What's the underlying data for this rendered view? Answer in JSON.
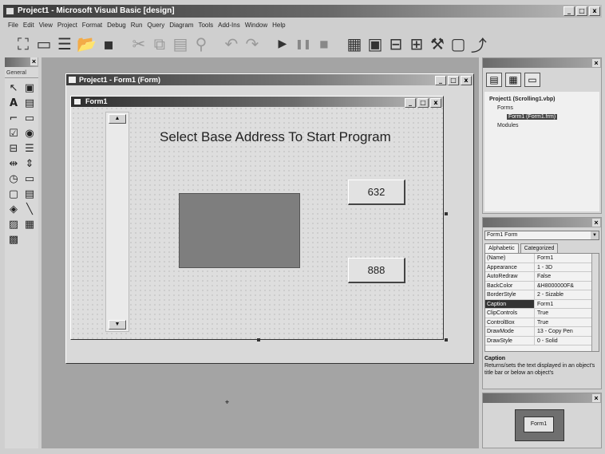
{
  "window": {
    "title": "Project1 - Microsoft Visual Basic [design]",
    "minimize": "_",
    "maximize": "□",
    "close": "x"
  },
  "menu": [
    "File",
    "Edit",
    "View",
    "Project",
    "Format",
    "Debug",
    "Run",
    "Query",
    "Diagram",
    "Tools",
    "Add-Ins",
    "Window",
    "Help"
  ],
  "toolbar_icons": [
    "add-project-icon",
    "add-form-icon",
    "menu-editor-icon",
    "open-project-icon",
    "save-project-icon",
    "cut-icon",
    "copy-icon",
    "paste-icon",
    "find-icon",
    "undo-icon",
    "redo-icon",
    "start-icon",
    "break-icon",
    "end-icon",
    "project-explorer-icon",
    "properties-window-icon",
    "form-layout-icon",
    "object-browser-icon",
    "toolbox-icon",
    "data-view-icon",
    "component-manager-icon"
  ],
  "toolbox": {
    "header": "General"
  },
  "designer": {
    "title": "Project1 - Form1 (Form)"
  },
  "form": {
    "title": "Form1",
    "heading": "Select Base Address To Start Program",
    "button_632": "632",
    "button_888": "888"
  },
  "project_explorer": {
    "root": "Project1 (Scrolling1.vbp)",
    "forms_folder": "Forms",
    "form_item": "Form1 (Form1.frm)",
    "modules_folder": "Modules"
  },
  "properties": {
    "object": "Form1 Form",
    "tab_alphabetic": "Alphabetic",
    "tab_categorized": "Categorized",
    "rows": [
      {
        "name": "(Name)",
        "value": "Form1"
      },
      {
        "name": "Appearance",
        "value": "1 - 3D"
      },
      {
        "name": "AutoRedraw",
        "value": "False"
      },
      {
        "name": "BackColor",
        "value": "&H8000000F&"
      },
      {
        "name": "BorderStyle",
        "value": "2 - Sizable"
      },
      {
        "name": "Caption",
        "value": "Form1"
      },
      {
        "name": "ClipControls",
        "value": "True"
      },
      {
        "name": "ControlBox",
        "value": "True"
      },
      {
        "name": "DrawMode",
        "value": "13 - Copy Pen"
      },
      {
        "name": "DrawStyle",
        "value": "0 - Solid"
      }
    ],
    "selected_row": 5,
    "desc_title": "Caption",
    "desc_text": "Returns/sets the text displayed in an object's title bar or below an object's"
  },
  "form_layout": {
    "mini_label": "Form1"
  }
}
